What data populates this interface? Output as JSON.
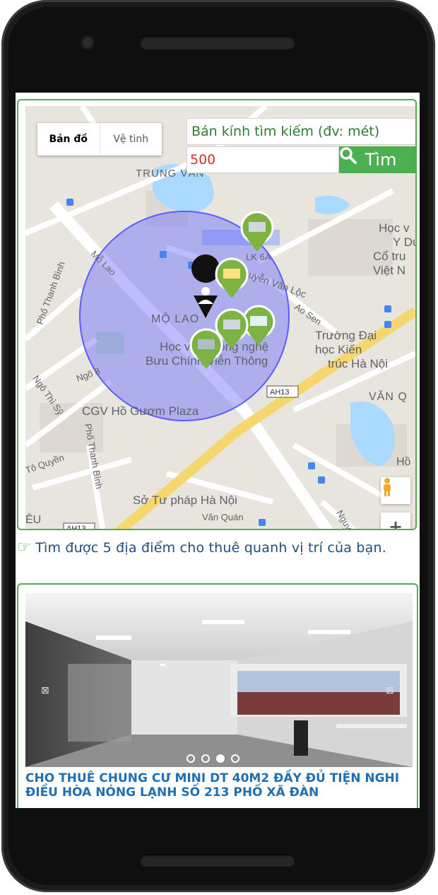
{
  "map": {
    "type_map": "Bản đồ",
    "type_satellite": "Vệ tinh",
    "labels": {
      "trung_van": "TRUNG VĂN",
      "hoc_vien_yd": "Học v",
      "hoc_vien_yd2": "Y Dư",
      "co_truyen": "Cổ tru",
      "viet_n": "Việt N",
      "mo_lao_road": "Mỗ Lao",
      "pho_thanh_binh": "Phố Thanh Bình",
      "lk6a": "LK 6A",
      "nguyen_van_loc": "Nguyễn Văn Lộc",
      "ao_sen": "Ao Sen",
      "mo_lao": "MỘ LAO",
      "hoc_vien": "Học viện Công nghệ",
      "buu_chinh": "Bưu Chính Viễn Thông",
      "truong_dai": "Trường Đại",
      "hoc_kien": "học Kiến",
      "truc_hanoi": "trúc Hà Nội",
      "ngo8": "Ngõ 8",
      "ah13": "AH13",
      "ngo_thi_sy": "Ngô Thì Sỹ",
      "cgv": "CGV Hồ Gươm Plaza",
      "van_q": "VĂN Q",
      "to_quyen": "Tô Quyền",
      "pho_thanh_binh2": "Phố Thanh Bình",
      "so_tu_phap": "Sở Tư pháp Hà Nội",
      "van_quan": "Văn Quán",
      "ho": "Hồ",
      "eu": "ÊU",
      "nguy": "Nguy"
    }
  },
  "search": {
    "radius_label": "Bán kính tìm kiếm (đv: mét)",
    "radius_value": "500",
    "button_label": "Tìm"
  },
  "result": {
    "text": "Tìm được 5 địa điểm cho thuê quanh vị trí của bạn."
  },
  "listing": {
    "title": "CHO THUÊ CHUNG CƯ MINI DT 40M2 ĐẦY ĐỦ TIỆN NGHI ĐIỀU HÒA NÓNG LẠNH SỐ 213 PHỐ XÃ ĐÀN",
    "slides": 4,
    "active_slide": 3
  },
  "colors": {
    "accent_green": "#4caf50",
    "title_blue": "#1f6fb2",
    "result_text": "#1f4e79",
    "radius_value": "#d32f2f"
  }
}
